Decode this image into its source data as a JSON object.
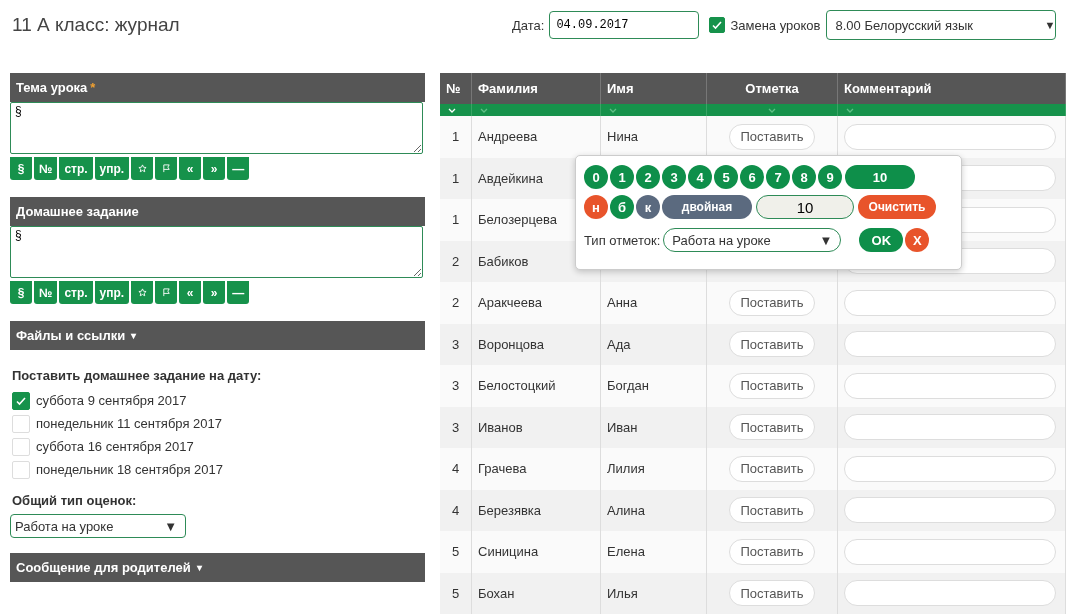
{
  "page_title": "11 А класс: журнал",
  "header": {
    "date_label": "Дата:",
    "date_value": "04.09.2017",
    "substitution": {
      "label": "Замена уроков",
      "checked": true
    },
    "lesson_select": {
      "value": "8.00 Белорусский язык",
      "arrow": "▼"
    }
  },
  "lesson_topic": {
    "title": "Тема урока",
    "required_mark": "*",
    "value": "§",
    "toolbar": [
      {
        "kind": "text",
        "label": "§"
      },
      {
        "kind": "text",
        "label": "№"
      },
      {
        "kind": "text",
        "label": "стр."
      },
      {
        "kind": "text",
        "label": "упр."
      },
      {
        "kind": "star"
      },
      {
        "kind": "flag"
      },
      {
        "kind": "text",
        "label": "«"
      },
      {
        "kind": "text",
        "label": "»"
      },
      {
        "kind": "text",
        "label": "—"
      }
    ]
  },
  "homework": {
    "title": "Домашнее задание",
    "value": "§",
    "toolbar": [
      {
        "kind": "text",
        "label": "§"
      },
      {
        "kind": "text",
        "label": "№"
      },
      {
        "kind": "text",
        "label": "стр."
      },
      {
        "kind": "text",
        "label": "упр."
      },
      {
        "kind": "star"
      },
      {
        "kind": "flag"
      },
      {
        "kind": "text",
        "label": "«"
      },
      {
        "kind": "text",
        "label": "»"
      },
      {
        "kind": "text",
        "label": "—"
      }
    ]
  },
  "files_section": {
    "title": "Файлы и ссылки",
    "arrow": "▾"
  },
  "homework_dates": {
    "label": "Поставить домашнее задание на дату:",
    "options": [
      {
        "label": "суббота 9 сентября 2017",
        "checked": true
      },
      {
        "label": "понедельник 11 сентября 2017",
        "checked": false
      },
      {
        "label": "суббота 16 сентября 2017",
        "checked": false
      },
      {
        "label": "понедельник 18 сентября 2017",
        "checked": false
      }
    ]
  },
  "grade_type": {
    "label": "Общий тип оценок:",
    "value": "Работа на уроке",
    "arrow": "▼"
  },
  "parents_section": {
    "title": "Сообщение для родителей",
    "arrow": "▾"
  },
  "table": {
    "columns": [
      "№",
      "Фамилия",
      "Имя",
      "Отметка",
      "Комментарий"
    ],
    "rows": [
      {
        "group": "1",
        "last_name": "Андреева",
        "first_name": "Нина",
        "mark_button": "Поставить"
      },
      {
        "group": "1",
        "last_name": "Авдейкина"
      },
      {
        "group": "1",
        "last_name": "Белозерцева"
      },
      {
        "group": "2",
        "last_name": "Бабиков"
      },
      {
        "group": "2",
        "last_name": "Аракчеева",
        "first_name": "Анна",
        "mark_button": "Поставить"
      },
      {
        "group": "3",
        "last_name": "Воронцова",
        "first_name": "Ада",
        "mark_button": "Поставить"
      },
      {
        "group": "3",
        "last_name": "Белостоцкий",
        "first_name": "Богдан",
        "mark_button": "Поставить"
      },
      {
        "group": "3",
        "last_name": "Иванов",
        "first_name": "Иван",
        "mark_button": "Поставить"
      },
      {
        "group": "4",
        "last_name": "Грачева",
        "first_name": "Лилия",
        "mark_button": "Поставить"
      },
      {
        "group": "4",
        "last_name": "Березявка",
        "first_name": "Алина",
        "mark_button": "Поставить"
      },
      {
        "group": "5",
        "last_name": "Синицина",
        "first_name": "Елена",
        "mark_button": "Поставить"
      },
      {
        "group": "5",
        "last_name": "Бохан",
        "first_name": "Илья",
        "mark_button": "Поставить"
      }
    ]
  },
  "mark_popup": {
    "grades": [
      {
        "label": "0",
        "kind": "round"
      },
      {
        "label": "1",
        "kind": "round"
      },
      {
        "label": "2",
        "kind": "round"
      },
      {
        "label": "3",
        "kind": "round"
      },
      {
        "label": "4",
        "kind": "round"
      },
      {
        "label": "5",
        "kind": "round"
      },
      {
        "label": "6",
        "kind": "round"
      },
      {
        "label": "7",
        "kind": "round"
      },
      {
        "label": "8",
        "kind": "round"
      },
      {
        "label": "9",
        "kind": "round"
      },
      {
        "label": "10",
        "kind": "wide"
      }
    ],
    "specials": [
      {
        "label": "н",
        "color": "#e8542b",
        "kind": "round"
      },
      {
        "label": "б",
        "color": "#0e8f4a",
        "kind": "round"
      },
      {
        "label": "к",
        "color": "#5b6a7f",
        "kind": "round"
      },
      {
        "label": "двойная",
        "color": "#5b6a7f",
        "kind": "wide"
      }
    ],
    "value": "10",
    "clear_button": "Очистить",
    "type_label": "Тип отметок:",
    "type_value": "Работа на уроке",
    "type_arrow": "▼",
    "ok_button": "OK",
    "cancel_button": "X"
  }
}
